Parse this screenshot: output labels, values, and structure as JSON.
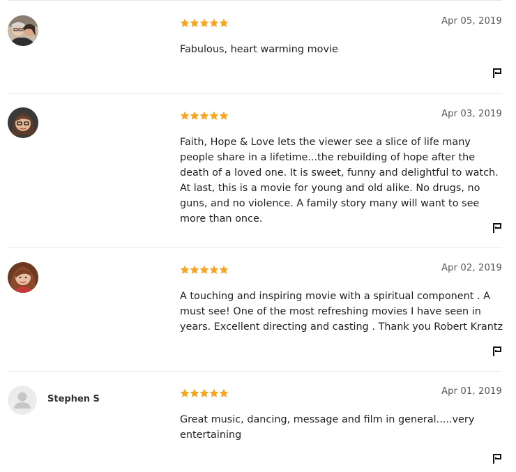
{
  "rating_color": "#f5a623",
  "icons": {
    "star": "star-icon",
    "flag": "flag-icon"
  },
  "reviews": [
    {
      "reviewer_name": "",
      "avatar": "reviewer-photo",
      "rating": 5,
      "date": "Apr 05, 2019",
      "text": "Fabulous, heart warming movie"
    },
    {
      "reviewer_name": "",
      "avatar": "reviewer-photo",
      "rating": 5,
      "date": "Apr 03, 2019",
      "text": "Faith, Hope & Love lets the viewer see a slice of life many people share in a lifetime...the rebuilding of hope after the death of a loved one. It is sweet, funny and delightful to watch. At last, this is a movie for young and old alike. No drugs, no guns, and no violence. A family story many will want to see more than once."
    },
    {
      "reviewer_name": "",
      "avatar": "reviewer-photo",
      "rating": 5,
      "date": "Apr 02, 2019",
      "text": "A touching and inspiring movie with a spiritual component . A must see! One of the most refreshing movies I have seen in years. Excellent directing and casting . Thank you Robert Krantz"
    },
    {
      "reviewer_name": "Stephen S",
      "avatar": "default-user-avatar",
      "rating": 5,
      "date": "Apr 01, 2019",
      "text": "Great music, dancing, message and film in general.....very entertaining"
    }
  ]
}
